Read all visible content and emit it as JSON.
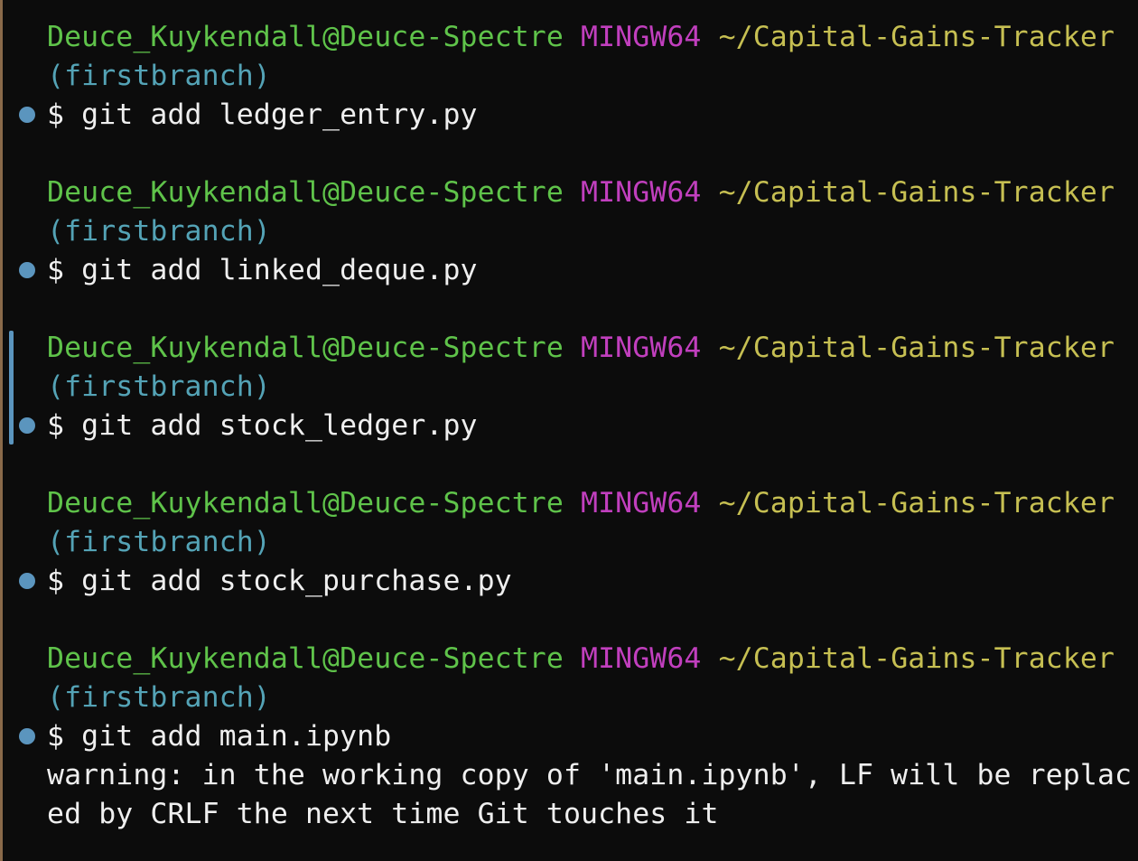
{
  "colors": {
    "user_host": "#5fc34a",
    "system": "#c13fbe",
    "path": "#c6bf52",
    "branch": "#54a3b6",
    "text": "#efefef",
    "marker": "#5b95be",
    "background": "#0c0c0c"
  },
  "blocks": [
    {
      "user_host": "Deuce_Kuykendall@Deuce-Spectre",
      "system": "MINGW64",
      "path": "~/Capital-Gains-Tracker",
      "branch": "(firstbranch)",
      "command": "$ git add ledger_entry.py"
    },
    {
      "user_host": "Deuce_Kuykendall@Deuce-Spectre",
      "system": "MINGW64",
      "path": "~/Capital-Gains-Tracker",
      "branch": "(firstbranch)",
      "command": "$ git add linked_deque.py"
    },
    {
      "user_host": "Deuce_Kuykendall@Deuce-Spectre",
      "system": "MINGW64",
      "path": "~/Capital-Gains-Tracker",
      "branch": "(firstbranch)",
      "command": "$ git add stock_ledger.py"
    },
    {
      "user_host": "Deuce_Kuykendall@Deuce-Spectre",
      "system": "MINGW64",
      "path": "~/Capital-Gains-Tracker",
      "branch": "(firstbranch)",
      "command": "$ git add stock_purchase.py"
    },
    {
      "user_host": "Deuce_Kuykendall@Deuce-Spectre",
      "system": "MINGW64",
      "path": "~/Capital-Gains-Tracker",
      "branch": "(firstbranch)",
      "command": "$ git add main.ipynb"
    }
  ],
  "output": {
    "warning_line_1": "warning: in the working copy of 'main.ipynb', LF will be replac",
    "warning_line_2": "ed by CRLF the next time Git touches it"
  }
}
